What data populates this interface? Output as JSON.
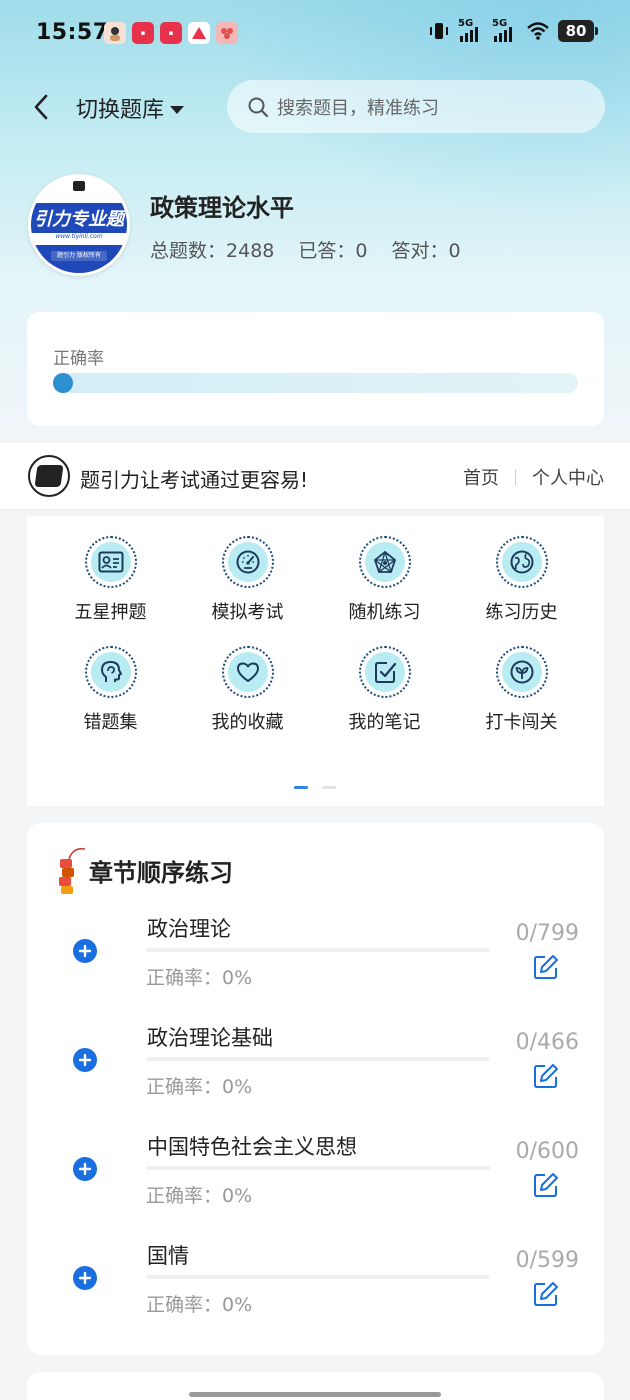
{
  "status_bar": {
    "time": "15:57",
    "network_1": "5G",
    "network_2": "5G",
    "battery": "80"
  },
  "nav": {
    "switch_label": "切换题库",
    "search_placeholder": "搜索题目，精准练习"
  },
  "bank": {
    "title": "政策理论水平",
    "avatar_banner": "引力专业题",
    "avatar_url": "www.tiyinli.com",
    "avatar_footer": "题引力 版权所有",
    "stats": [
      {
        "label": "总题数",
        "value": "2488"
      },
      {
        "label": "已答",
        "value": "0"
      },
      {
        "label": "答对",
        "value": "0"
      }
    ]
  },
  "accuracy": {
    "label": "正确率",
    "value": 0
  },
  "brand": {
    "slogan": "题引力让考试通过更容易!",
    "links": [
      "首页",
      "个人中心"
    ]
  },
  "grid": {
    "items": [
      {
        "label": "五星押题",
        "icon": "id-card-icon"
      },
      {
        "label": "模拟考试",
        "icon": "speedometer-icon"
      },
      {
        "label": "随机练习",
        "icon": "network-icon"
      },
      {
        "label": "练习历史",
        "icon": "globe-icon"
      },
      {
        "label": "错题集",
        "icon": "head-icon"
      },
      {
        "label": "我的收藏",
        "icon": "heart-icon"
      },
      {
        "label": "我的笔记",
        "icon": "note-check-icon"
      },
      {
        "label": "打卡闯关",
        "icon": "sprout-icon"
      }
    ],
    "page_index": 0,
    "page_count": 2
  },
  "chapters": {
    "title": "章节顺序练习",
    "items": [
      {
        "name": "政治理论",
        "accuracy": "正确率：0%",
        "count": "0/799"
      },
      {
        "name": "政治理论基础",
        "accuracy": "正确率：0%",
        "count": "0/466"
      },
      {
        "name": "中国特色社会主义思想",
        "accuracy": "正确率：0%",
        "count": "0/600"
      },
      {
        "name": "国情",
        "accuracy": "正确率：0%",
        "count": "0/599"
      }
    ]
  },
  "colors": {
    "accent": "#1a6fe0",
    "icon_bg": "#b9ecf2",
    "icon_ring": "#1d4b7a"
  }
}
